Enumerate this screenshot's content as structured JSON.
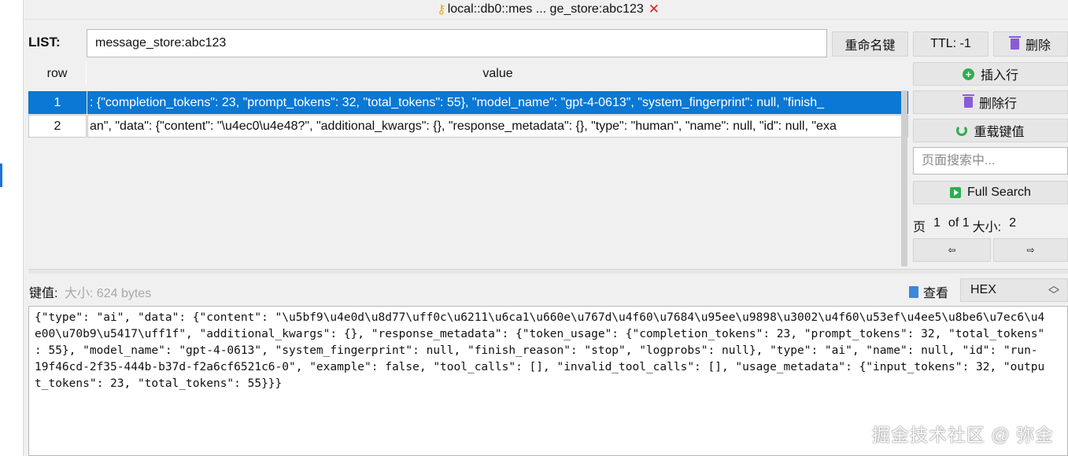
{
  "tab": {
    "title": "local::db0::mes ... ge_store:abc123",
    "close": "✕"
  },
  "header": {
    "type_label": "LIST:",
    "key_name": "message_store:abc123",
    "rename_label": "重命名键",
    "ttl_label": "TTL:  -1",
    "delete_label": "删除"
  },
  "table": {
    "columns": [
      "row",
      "value"
    ],
    "rows": [
      {
        "row": "1",
        "value": ": {\"completion_tokens\": 23, \"prompt_tokens\": 32, \"total_tokens\": 55}, \"model_name\": \"gpt-4-0613\", \"system_fingerprint\": null, \"finish_"
      },
      {
        "row": "2",
        "value": "an\", \"data\": {\"content\": \"\\u4ec0\\u4e48?\", \"additional_kwargs\": {}, \"response_metadata\": {}, \"type\": \"human\", \"name\": null, \"id\": null, \"exa"
      }
    ]
  },
  "side": {
    "insert_label": "插入行",
    "delete_row_label": "删除行",
    "reload_label": "重载键值",
    "search_placeholder": "页面搜索中...",
    "full_search_label": "Full Search",
    "page_label": "页",
    "page_current": "1",
    "page_of": "of 1",
    "size_label": "大小:",
    "size_value": "2",
    "prev_arrow": "⇦",
    "next_arrow": "⇨"
  },
  "value_panel": {
    "label": "键值:",
    "size_text": "大小: 624 bytes",
    "view_label": "查看",
    "format": "HEX",
    "lines": [
      "{\"type\": \"ai\", \"data\": {\"content\": \"\\u5bf9\\u4e0d\\u8d77\\uff0c\\u6211\\u6ca1\\u660e\\u767d\\u4f60\\u7684\\u95ee\\u9898\\u3002\\u4f60\\u53ef\\u4ee5\\u8be6\\u7ec6\\u4",
      "e00\\u70b9\\u5417\\uff1f\", \"additional_kwargs\": {}, \"response_metadata\": {\"token_usage\": {\"completion_tokens\": 23, \"prompt_tokens\": 32, \"total_tokens\"",
      ": 55}, \"model_name\": \"gpt-4-0613\", \"system_fingerprint\": null, \"finish_reason\": \"stop\", \"logprobs\": null}, \"type\": \"ai\", \"name\": null, \"id\": \"run-",
      "19f46cd-2f35-444b-b37d-f2a6cf6521c6-0\", \"example\": false, \"tool_calls\": [], \"invalid_tool_calls\": [], \"usage_metadata\": {\"input_tokens\": 32, \"outpu",
      "t_tokens\": 23, \"total_tokens\": 55}}}"
    ]
  },
  "watermark": "掘金技术社区 @ 弥金",
  "colors": {
    "selection": "#0a78d4",
    "accent_green": "#2eae4f",
    "trash_purple": "#8b5bd6"
  }
}
